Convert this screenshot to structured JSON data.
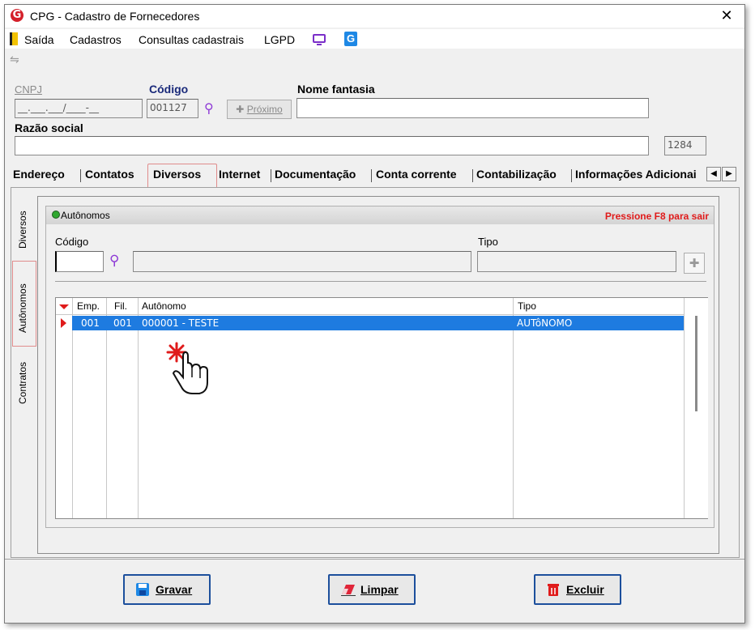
{
  "window": {
    "title": "CPG - Cadastro de Fornecedores",
    "close": "✕"
  },
  "menu": {
    "items": [
      "Saída",
      "Cadastros",
      "Consultas cadastrais",
      "LGPD"
    ],
    "g_label": "G"
  },
  "form": {
    "cnpj_label": "CNPJ",
    "cnpj_mask": "__.___.___/____-__",
    "codigo_label": "Código",
    "codigo_value": "001127",
    "proximo_label": "Próximo",
    "nome_fantasia_label": "Nome fantasia",
    "nome_fantasia_value": "",
    "razao_social_label": "Razão social",
    "razao_social_value": "",
    "counter_value": "1284"
  },
  "tabs": [
    "Endereço",
    "Contatos",
    "Diversos",
    "Internet",
    "Documentação",
    "Conta corrente",
    "Contabilização",
    "Informações Adicionai"
  ],
  "active_tab": "Diversos",
  "vertical_tabs": [
    "Diversos",
    "Autônomos",
    "Contratos"
  ],
  "active_vertical_tab": "Autônomos",
  "group": {
    "title": "Autônomos",
    "hint": "Pressione F8 para sair",
    "codigo_label": "Código",
    "codigo_value": "",
    "tipo_label": "Tipo",
    "tipo_value": ""
  },
  "grid": {
    "columns": [
      "Emp.",
      "Fil.",
      "Autônomo",
      "Tipo"
    ],
    "rows": [
      {
        "emp": "001",
        "fil": "001",
        "autonomo": "000001 - TESTE",
        "tipo": "AUTôNOMO"
      }
    ]
  },
  "footer": {
    "gravar": "Gravar",
    "limpar": "Limpar",
    "excluir": "Excluir"
  },
  "colors": {
    "accent_red": "#e01b1b",
    "selection_blue": "#1e7be0",
    "button_border": "#1c4f9c",
    "icon_purple": "#8e3ad6"
  }
}
